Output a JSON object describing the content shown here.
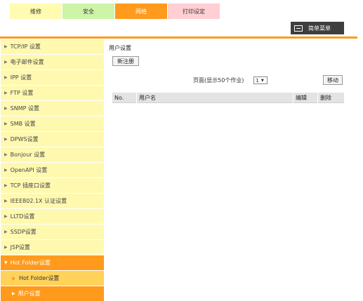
{
  "tabs": [
    {
      "label": "维修"
    },
    {
      "label": "安全"
    },
    {
      "label": "网络"
    },
    {
      "label": "打印设定"
    }
  ],
  "menu_button": {
    "label": "简单菜单",
    "icon": "window-icon"
  },
  "sidebar": {
    "items": [
      {
        "label": "TCP/IP 设置"
      },
      {
        "label": "电子邮件设置"
      },
      {
        "label": "IPP 设置"
      },
      {
        "label": "FTP 设置"
      },
      {
        "label": "SNMP 设置"
      },
      {
        "label": "SMB 设置"
      },
      {
        "label": "DPWS设置"
      },
      {
        "label": "Bonjour 设置"
      },
      {
        "label": "OpenAPI 设置"
      },
      {
        "label": "TCP 插座口设置"
      },
      {
        "label": "IEEE802.1X 认证设置"
      },
      {
        "label": "LLTD设置"
      },
      {
        "label": "SSDP设置"
      },
      {
        "label": "JSP设置"
      },
      {
        "label": "Hot Folder设置"
      }
    ],
    "sub_items": [
      {
        "label": "Hot Folder设置"
      },
      {
        "label": "用户设置"
      }
    ]
  },
  "main": {
    "title": "用户设置",
    "new_button": "新注册",
    "page_label": "页面(显示50个作业)",
    "page_value": "1",
    "move_button": "移动",
    "columns": [
      "No.",
      "用户名",
      "编辑",
      "删除"
    ]
  }
}
